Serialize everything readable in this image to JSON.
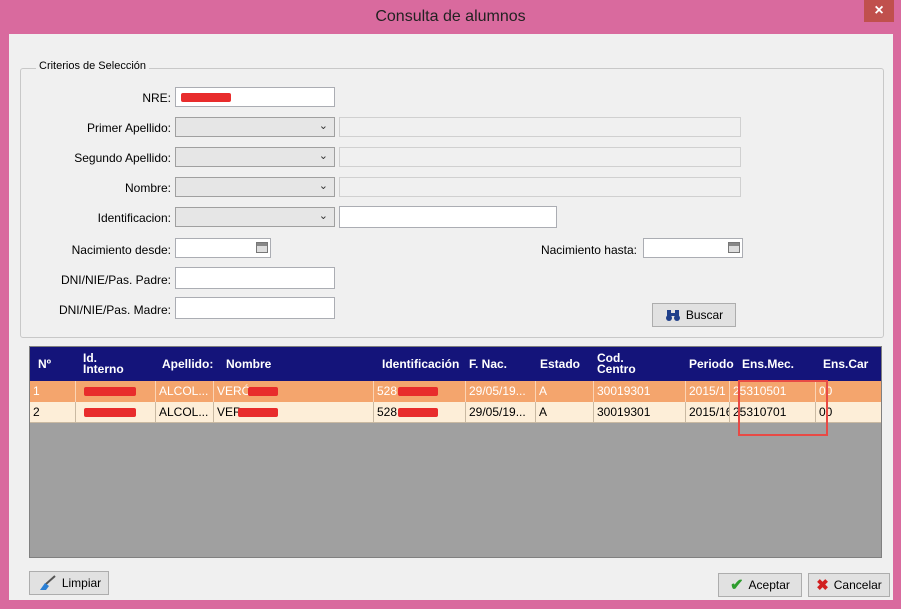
{
  "window": {
    "title": "Consulta de alumnos",
    "close_glyph": "×"
  },
  "criteria": {
    "legend": "Criterios de Selección",
    "nre_label": "NRE:",
    "primer_apellido_label": "Primer Apellido:",
    "segundo_apellido_label": "Segundo Apellido:",
    "nombre_label": "Nombre:",
    "identificacion_label": "Identificacion:",
    "nacimiento_desde_label": "Nacimiento desde:",
    "nacimiento_hasta_label": "Nacimiento hasta:",
    "dni_padre_label": "DNI/NIE/Pas. Padre:",
    "dni_madre_label": "DNI/NIE/Pas. Madre:",
    "dropdown_arrow": "⌄",
    "buscar_label": "Buscar",
    "buscar_icon": "binoculars-icon"
  },
  "grid": {
    "columns": [
      "Nº",
      "Id. Interno",
      "Apellido:",
      "Nombre",
      "Identificación",
      "F. Nac.",
      "Estado",
      "Cod. Centro",
      "Periodo",
      "Ens.Mec.",
      "Ens.Car"
    ],
    "rows": [
      {
        "n": "1",
        "apellido": "ALCOL...",
        "nombre": "VERÓ",
        "identificacion": "528",
        "fnac": "29/05/19...",
        "estado": "A",
        "centro": "30019301",
        "periodo": "2015/1",
        "ensmec": "25310501",
        "enscar": "00"
      },
      {
        "n": "2",
        "apellido": "ALCOL...",
        "nombre": "VER",
        "identificacion": "528",
        "fnac": "29/05/19...",
        "estado": "A",
        "centro": "30019301",
        "periodo": "2015/16",
        "ensmec": "25310701",
        "enscar": "00"
      }
    ]
  },
  "footer": {
    "limpiar_label": "Limpiar",
    "aceptar_label": "Aceptar",
    "cancelar_label": "Cancelar"
  },
  "colors": {
    "titlebar": "#d96a9e",
    "grid_header": "#14147a",
    "row_selected": "#f4a56d",
    "row_alt": "#fdeed8",
    "annotation": "#e84a45"
  }
}
